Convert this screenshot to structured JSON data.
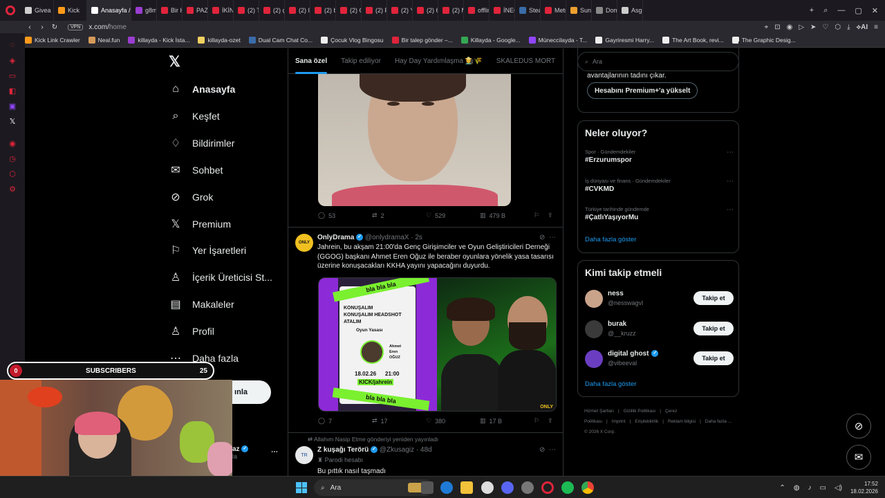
{
  "browser": {
    "tabs": [
      {
        "label": "Givea",
        "color": "#cfcfcf"
      },
      {
        "label": "Kick",
        "color": "#ff9a1a"
      },
      {
        "label": "Anasayfa /",
        "color": "#ffffff",
        "active": true
      },
      {
        "label": "g8mh",
        "color": "#9b3dd1"
      },
      {
        "label": "Bir H",
        "color": "#e0243b"
      },
      {
        "label": "PAZA",
        "color": "#e0243b"
      },
      {
        "label": "İKİNC",
        "color": "#e0243b"
      },
      {
        "label": "(2) Tı",
        "color": "#e0243b"
      },
      {
        "label": "(2) ç",
        "color": "#e0243b"
      },
      {
        "label": "(2) Id",
        "color": "#e0243b"
      },
      {
        "label": "(2) bı",
        "color": "#e0243b"
      },
      {
        "label": "(2) Ç",
        "color": "#e0243b"
      },
      {
        "label": "(2) Fı",
        "color": "#e0243b"
      },
      {
        "label": "(2) Yı",
        "color": "#e0243b"
      },
      {
        "label": "(2) 6ı",
        "color": "#e0243b"
      },
      {
        "label": "(2) M",
        "color": "#e0243b"
      },
      {
        "label": "offlin",
        "color": "#e0243b"
      },
      {
        "label": "İNEĞ",
        "color": "#e0243b"
      },
      {
        "label": "Stean",
        "color": "#3b6ca8"
      },
      {
        "label": "Metrc",
        "color": "#e0243b"
      },
      {
        "label": "Suno",
        "color": "#f0a030"
      },
      {
        "label": "Domi",
        "color": "#888888"
      },
      {
        "label": "Asgai",
        "color": "#cccccc"
      }
    ],
    "url": "x.com/",
    "url_path": "home",
    "vpn": "VPN",
    "ai_label": "AI",
    "bookmarks": [
      {
        "label": "Kick Link Crawler",
        "color": "#ff9a1a"
      },
      {
        "label": "Neal.fun",
        "color": "#d49a5a"
      },
      {
        "label": "killayda - Kick İsta...",
        "color": "#9b3dd1"
      },
      {
        "label": "killayda-ozet",
        "color": "#f0d060"
      },
      {
        "label": "Dual Cam Chat Co...",
        "color": "#3b6ca8"
      },
      {
        "label": "Çocuk Vlog Bingosu",
        "color": "#eeeeee"
      },
      {
        "label": "Bir talep gönder –...",
        "color": "#e0243b"
      },
      {
        "label": "Killayda - Google...",
        "color": "#34a853"
      },
      {
        "label": "Müneccilayda - T...",
        "color": "#9146ff"
      },
      {
        "label": "Gayriresmi Harry...",
        "color": "#eeeeee"
      },
      {
        "label": "The Art Book, revi...",
        "color": "#eeeeee"
      },
      {
        "label": "The Graphic Desig...",
        "color": "#eeeeee"
      }
    ]
  },
  "x": {
    "logo": "𝕏",
    "nav": [
      {
        "label": "Anasayfa",
        "icon": "home-icon",
        "glyph": "⌂"
      },
      {
        "label": "Keşfet",
        "icon": "search-icon",
        "glyph": "⌕"
      },
      {
        "label": "Bildirimler",
        "icon": "bell-icon",
        "glyph": "♢"
      },
      {
        "label": "Sohbet",
        "icon": "mail-icon",
        "glyph": "✉"
      },
      {
        "label": "Grok",
        "icon": "grok-icon",
        "glyph": "⊘"
      },
      {
        "label": "Premium",
        "icon": "x-premium-icon",
        "glyph": "𝕏"
      },
      {
        "label": "Yer İşaretleri",
        "icon": "bookmark-icon",
        "glyph": "⚐"
      },
      {
        "label": "İçerik Üreticisi St...",
        "icon": "creator-studio-icon",
        "glyph": "♙"
      },
      {
        "label": "Makaleler",
        "icon": "articles-icon",
        "glyph": "▤"
      },
      {
        "label": "Profil",
        "icon": "profile-icon",
        "glyph": "♙"
      },
      {
        "label": "Daha fazla",
        "icon": "more-icon",
        "glyph": "⋯"
      }
    ],
    "post_button": "ınla",
    "account_name": "az",
    "account_handle": "la",
    "feed_tabs": [
      "Sana özel",
      "Takip ediliyor",
      "Hay Day Yardımlaşma 👩‍🌾🌾",
      "SKALEDUS MORT"
    ],
    "tweet1_actions": {
      "replies": "53",
      "reposts": "2",
      "likes": "529",
      "views": "479 B"
    },
    "tweet2": {
      "name": "OnlyDrama",
      "handle": "@onlydramaX",
      "time": "· 2s",
      "text": "Jahrein, bu akşam 21:00'da Genç Girişimciler ve Oyun Geliştiricileri Derneği (GGOG) başkanı Ahmet Eren Oğuz ile beraber oyunlara yönelik yasa tasarısı üzerine konuşacakları KKHA yayını yapacağını duyurdu.",
      "media_card": {
        "stripe": "bla bla bla",
        "line1": "KONUŞALIM",
        "line2": "KONUŞALIM HEADSHOT",
        "line3": "ATALIM",
        "line4": "Oyun Yasası",
        "name1": "Ahmet",
        "name2": "Eren",
        "name3": "OĞUZ",
        "date": "18.02.26",
        "hour": "21:00",
        "channel": "KICK/jahrein",
        "brand": "ONLY"
      },
      "actions": {
        "replies": "7",
        "reposts": "17",
        "likes": "380",
        "views": "17 B"
      }
    },
    "tweet3": {
      "reposted_by": "Allahım Nasip Etme gönderiyi yeniden yayınladı",
      "name": "Z kuşağı Terörü",
      "handle": "@Zkusagiz",
      "time": "· 48d",
      "badge": "Parodi hesabı",
      "text": "Bu pıttık nasıl taşmadı"
    },
    "search_placeholder": "Ara",
    "premium": {
      "text": "avantajlarının tadını çıkar.",
      "button": "Hesabını Premium+'a yükselt"
    },
    "trends_title": "Neler oluyor?",
    "trends": [
      {
        "meta": "Spor · Gündemdekiler",
        "tag": "#Erzurumspor"
      },
      {
        "meta": "İş dünyası ve finans · Gündemdekiler",
        "tag": "#CVKMD"
      },
      {
        "meta": "Türkiye tarihinde gündemde",
        "tag": "#ÇatlıYaşıyorMu"
      }
    ],
    "show_more": "Daha fazla göster",
    "who_title": "Kimi takip etmeli",
    "who": [
      {
        "name": "ness",
        "handle": "@nesswagvl",
        "color": "#c9a38a",
        "verified": false
      },
      {
        "name": "burak",
        "handle": "@__kruzz",
        "color": "#3a3a3a",
        "verified": false
      },
      {
        "name": "digital ghost",
        "handle": "@vibeeval",
        "color": "#6b3ec1",
        "verified": true
      }
    ],
    "follow_label": "Takip et",
    "footer": [
      "Hizmet Şartları",
      "|",
      "Gizlilik Politikası",
      "|",
      "Çerez Politikası",
      "|",
      "Imprint",
      "|",
      "Erişilebilirlik",
      "|",
      "Reklam bilgisi",
      "|",
      "Daha fazla ...",
      "© 2026 X Corp."
    ]
  },
  "overlay": {
    "subs_current": "0",
    "subs_label": "SUBSCRIBERS",
    "subs_goal": "25"
  },
  "taskbar": {
    "search": "Ara",
    "time": "17:52",
    "date": "18.02.2026"
  }
}
